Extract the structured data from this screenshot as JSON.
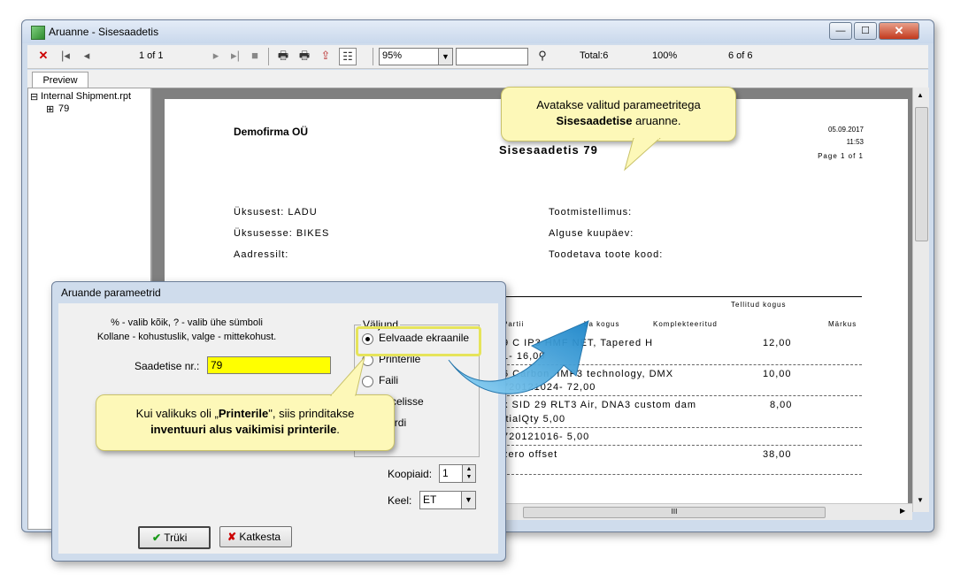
{
  "window": {
    "title": "Aruanne - Sisesaadetis",
    "min_label": "—",
    "max_label": "☐",
    "close_label": "✕"
  },
  "toolbar": {
    "page_indicator": "1 of 1",
    "zoom": "95%",
    "search_value": "",
    "total": "Total:6",
    "percent": "100%",
    "records": "6 of 6"
  },
  "tabs": {
    "preview": "Preview"
  },
  "tree": {
    "root": "Internal Shipment.rpt",
    "child": "79",
    "root_toggle": "⊟",
    "child_toggle": "⊞"
  },
  "report": {
    "company": "Demofirma OÜ",
    "title": "Sisesaadetis  79",
    "date": "05.09.2017",
    "time": "11:53",
    "page": "Page 1 of 1",
    "from_label": "Üksusest: LADU",
    "to_label": "Üksusesse: BIKES",
    "address_label": "Aadressilt:",
    "order_label": "Tootmistellimus:",
    "start_label": "Alguse kuupäev:",
    "product_code_label": "Toodetava toote kood:",
    "col_ordered": "Tellitud kogus",
    "col_partii": "Partii",
    "col_stock": "ba kogus",
    "col_completed": "Komplekteeritud",
    "col_note": "Märkus",
    "rows": [
      {
        "line1": "9 C        IP3 HMF NET, Tapered H",
        "line2": "1-             16,00",
        "qty": "12,00"
      },
      {
        "line1": "6 Carbon, IMP3 technology, DMX",
        "line2": "720121024-          72,00",
        "qty": "10,00"
      },
      {
        "line1": "x SID 29 RLT3 Air, DNA3 custom dam",
        "line2": "itialQty                5,00",
        "qty": "8,00"
      },
      {
        "line1": "720121016-            5,00",
        "line2": "",
        "qty": ""
      },
      {
        "line1": "zero offset",
        "line2": "",
        "qty": "38,00"
      }
    ],
    "hscroll_label": "III"
  },
  "callouts": {
    "top_line1": "Avatakse valitud parameetritega",
    "top_line2_bold": "Sisesaadetise",
    "top_line2_rest": " aruanne.",
    "bottom_line1_pre": "Kui valikuks oli „",
    "bottom_line1_bold": "Printerile",
    "bottom_line1_post": "\", siis prinditakse",
    "bottom_line2_bold": "inventuuri alus vaikimisi printerile",
    "bottom_line2_post": "."
  },
  "dialog": {
    "title": "Aruande parameetrid",
    "hint1": "% - valib kõik, ? - valib ühe sümboli",
    "hint2": "Kollane - kohustuslik, valge - mittekohust.",
    "shipment_label": "Saadetise nr.:",
    "shipment_value": "79",
    "output_group": "Väljund",
    "options": [
      "Eelvaade ekraanile",
      "Printerile",
      "Faili",
      "Excelisse",
      "Wordi"
    ],
    "copies_label": "Koopiaid:",
    "copies_value": "1",
    "lang_label": "Keel:",
    "lang_value": "ET",
    "print_button": "Trüki",
    "cancel_button": "Katkesta"
  },
  "colors": {
    "required_field": "#ffff00",
    "callout_bg": "#fdf8b8",
    "arrow": "#3aa0d8"
  }
}
